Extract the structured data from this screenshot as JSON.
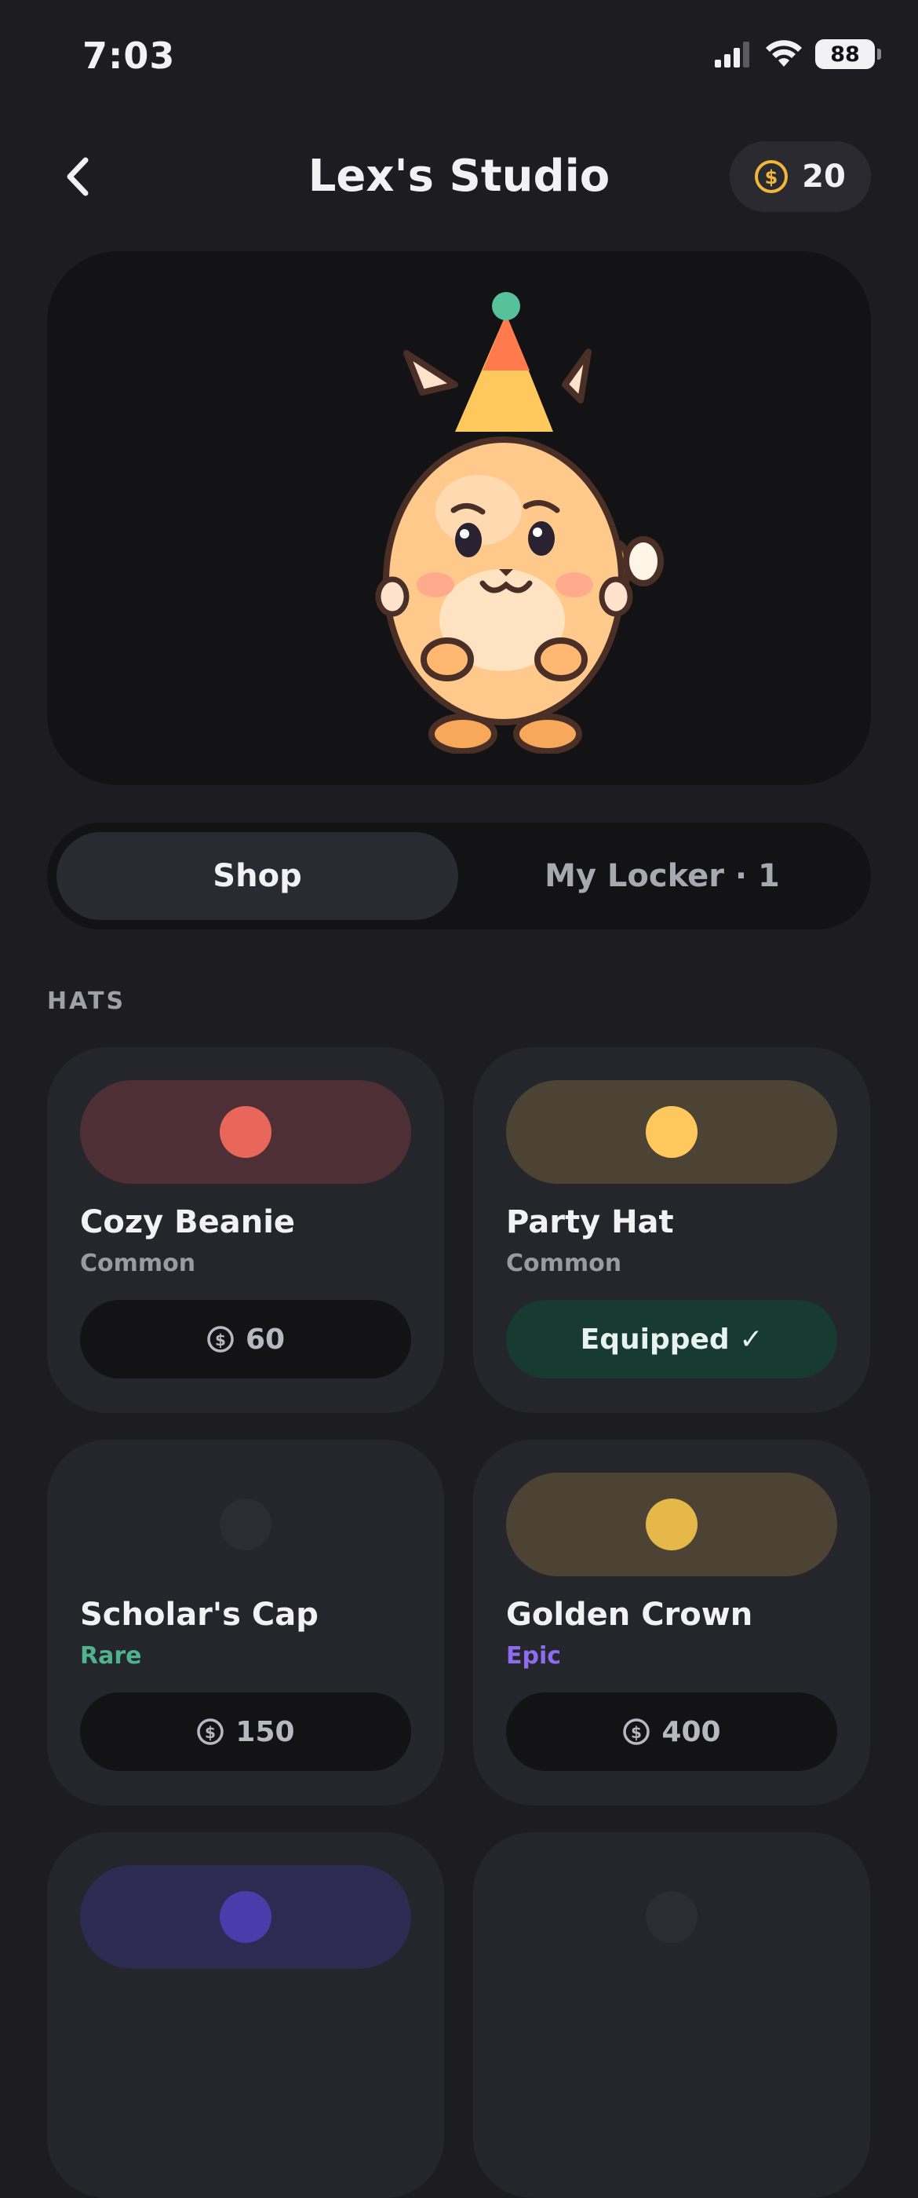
{
  "status_bar": {
    "time": "7:03",
    "battery": "88"
  },
  "header": {
    "title": "Lex's Studio",
    "coins": "20"
  },
  "tabs": {
    "shop": "Shop",
    "locker": "My Locker · 1"
  },
  "section": {
    "label": "HATS"
  },
  "items": [
    {
      "name": "Cozy Beanie",
      "rarity": "Common",
      "price": "60",
      "swatch_color": "#4e2f35",
      "dot_color": "#e8665a",
      "rarity_color": "#9a9aa2"
    },
    {
      "name": "Party Hat",
      "rarity": "Common",
      "action": "Equipped ✓",
      "swatch_color": "#4d4335",
      "dot_color": "#ffc85c",
      "rarity_color": "#9a9aa2"
    },
    {
      "name": "Scholar's Cap",
      "rarity": "Rare",
      "price": "150",
      "swatch_color": "#25252c",
      "dot_color": "#2c2c33",
      "rarity_color": "#4fb38f"
    },
    {
      "name": "Golden Crown",
      "rarity": "Epic",
      "price": "400",
      "swatch_color": "#4d4335",
      "dot_color": "#e6b84a",
      "rarity_color": "#8e6cf0"
    },
    {
      "swatch_color": "#2e2b52",
      "dot_color": "#4a3caa"
    },
    {
      "swatch_color": "#25252c",
      "dot_color": "#2c2c33"
    }
  ],
  "colors": {
    "accent_coin": "#f1b739",
    "background": "#1c1c21"
  }
}
